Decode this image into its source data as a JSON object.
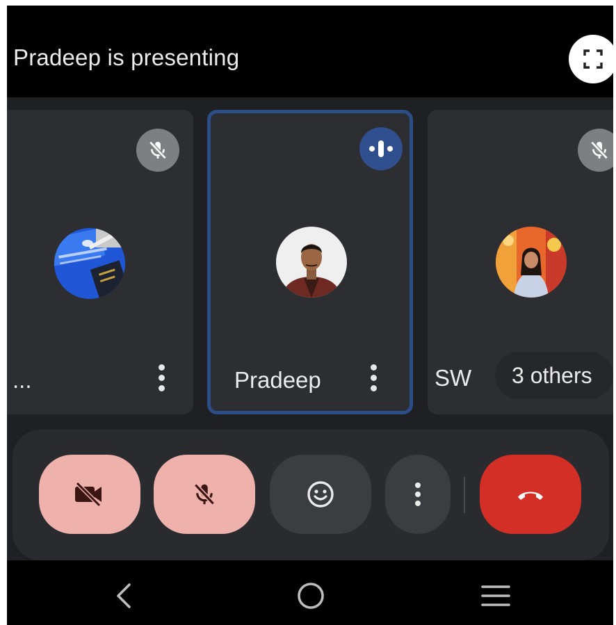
{
  "header": {
    "title": "Pradeep is presenting",
    "fullscreen_icon": "fullscreen-icon"
  },
  "participants": [
    {
      "name": "...",
      "status_icon": "mic-off-icon",
      "avatar": "photo-screen-document"
    },
    {
      "name": "Pradeep",
      "status_icon": "speaking-indicator-icon",
      "avatar": "photo-man-in-vest"
    },
    {
      "name": "SW",
      "status_icon": "mic-off-icon",
      "avatar": "photo-woman-sitting"
    }
  ],
  "others_pill": {
    "label": "3 others"
  },
  "controls": {
    "camera": "video-off-icon",
    "mic": "mic-off-icon",
    "reactions": "emoji-icon",
    "more": "more-vert-icon",
    "end_call": "call-end-icon"
  },
  "navigation": [
    "back-icon",
    "home-icon",
    "recents-icon"
  ],
  "colors": {
    "screen_bg": "#1f2023",
    "tile_bg": "#2d2e31",
    "active_tile_border": "#2c4e88",
    "muted_button_bg": "#efb1ac",
    "end_call_bg": "#d32f26"
  }
}
